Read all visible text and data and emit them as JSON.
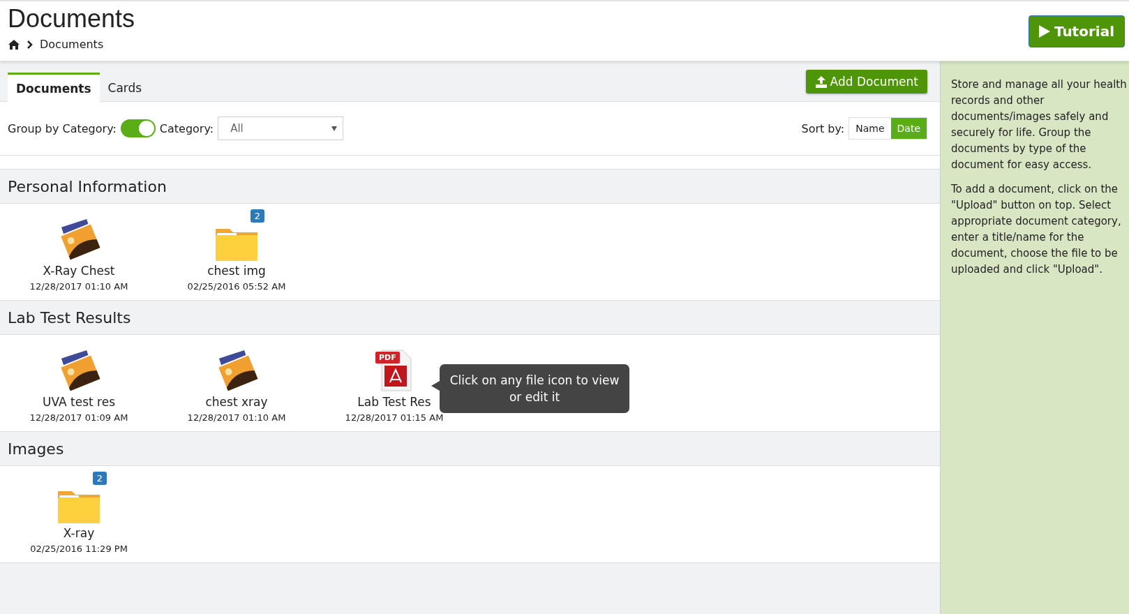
{
  "header": {
    "title": "Documents",
    "breadcrumb": [
      {
        "label": "Documents"
      }
    ],
    "tutorial_button": "Tutorial"
  },
  "tabs": [
    {
      "label": "Documents",
      "selected": true
    },
    {
      "label": "Cards",
      "selected": false
    }
  ],
  "add_button": "Add Document",
  "filters": {
    "group_label": "Group by Category:",
    "group_on": true,
    "category_label": "Category:",
    "category_value": "All",
    "sort_label": "Sort by:",
    "sort_options": [
      {
        "label": "Name",
        "selected": false
      },
      {
        "label": "Date",
        "selected": true
      }
    ]
  },
  "sections": [
    {
      "title": "Personal Information",
      "items": [
        {
          "kind": "image",
          "name": "X-Ray Chest",
          "date": "12/28/2017 01:10 AM"
        },
        {
          "kind": "folder",
          "name": "chest img",
          "date": "02/25/2016 05:52 AM",
          "count": "2"
        }
      ]
    },
    {
      "title": "Lab Test Results",
      "items": [
        {
          "kind": "image",
          "name": "UVA test res",
          "date": "12/28/2017 01:09 AM"
        },
        {
          "kind": "image",
          "name": "chest xray",
          "date": "12/28/2017 01:10 AM"
        },
        {
          "kind": "pdf",
          "name": "Lab Test Res",
          "date": "12/28/2017 01:15 AM",
          "pdf_label": "PDF",
          "tooltip": "Click on any file icon to view or edit it"
        }
      ]
    },
    {
      "title": "Images",
      "items": [
        {
          "kind": "folder",
          "name": "X-ray",
          "date": "02/25/2016 11:29 PM",
          "count": "2"
        }
      ]
    }
  ],
  "help": [
    "Store and manage all your health records and other documents/images safely and securely for life. Group the documents by type of the document for easy access.",
    "To add a document, click on the \"Upload\" button on top. Select appropriate document category, enter a title/name for the document, choose the file to be uploaded and click \"Upload\"."
  ]
}
